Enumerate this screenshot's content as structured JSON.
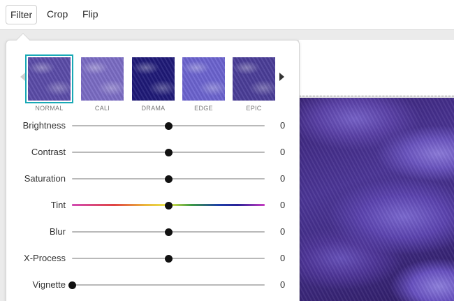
{
  "toolbar": {
    "tabs": [
      {
        "label": "Filter",
        "active": true
      },
      {
        "label": "Crop",
        "active": false
      },
      {
        "label": "Flip",
        "active": false
      }
    ]
  },
  "filters": {
    "selected": "NORMAL",
    "accent_color": "#19a9b5",
    "items": [
      {
        "label": "NORMAL",
        "tint": "#5a4ba8"
      },
      {
        "label": "CALI",
        "tint": "#7a6bc4"
      },
      {
        "label": "DRAMA",
        "tint": "#1f1a78"
      },
      {
        "label": "EDGE",
        "tint": "#6b63cf"
      },
      {
        "label": "EPIC",
        "tint": "#4a3d98"
      }
    ],
    "prev_icon": "caret-left-icon",
    "next_icon": "caret-right-icon"
  },
  "adjustments": [
    {
      "label": "Brightness",
      "value": "0",
      "position": 0.5,
      "track": "plain"
    },
    {
      "label": "Contrast",
      "value": "0",
      "position": 0.5,
      "track": "plain"
    },
    {
      "label": "Saturation",
      "value": "0",
      "position": 0.5,
      "track": "plain"
    },
    {
      "label": "Tint",
      "value": "0",
      "position": 0.5,
      "track": "rainbow"
    },
    {
      "label": "Blur",
      "value": "0",
      "position": 0.5,
      "track": "plain"
    },
    {
      "label": "X-Process",
      "value": "0",
      "position": 0.5,
      "track": "plain"
    },
    {
      "label": "Vignette",
      "value": "0",
      "position": 0.0,
      "track": "plain"
    }
  ]
}
